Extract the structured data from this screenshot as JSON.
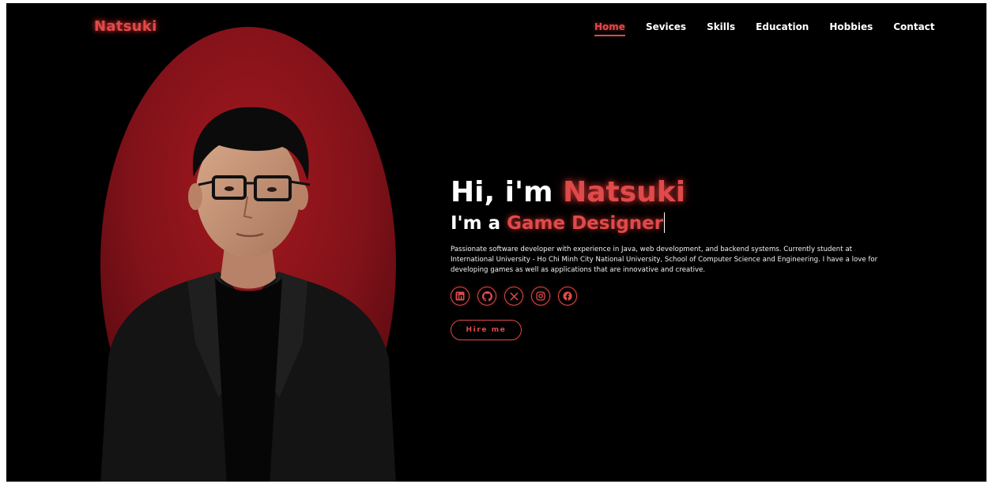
{
  "brand": {
    "name": "Natsuki"
  },
  "nav": {
    "items": [
      {
        "label": "Home",
        "active": true
      },
      {
        "label": "Sevices",
        "active": false
      },
      {
        "label": "Skills",
        "active": false
      },
      {
        "label": "Education",
        "active": false
      },
      {
        "label": "Hobbies",
        "active": false
      },
      {
        "label": "Contact",
        "active": false
      }
    ]
  },
  "hero": {
    "greeting_prefix": "Hi, i'm ",
    "greeting_name": "Natsuki",
    "role_prefix": "I'm a ",
    "role_highlight": "Game Designer",
    "bio": "Passionate software developer with experience in Java, web development, and backend systems. Currently student at International University - Ho Chi Minh City National University, School of Computer Science and Engineering. I have a love for developing games as well as applications that are innovative and creative.",
    "hire_label": "Hire me"
  },
  "socials": [
    {
      "icon": "linkedin-icon"
    },
    {
      "icon": "github-icon"
    },
    {
      "icon": "x-icon"
    },
    {
      "icon": "instagram-icon"
    },
    {
      "icon": "facebook-icon"
    }
  ],
  "colors": {
    "accent": "#e04a4a",
    "background": "#000000",
    "portrait_bg": "#8e1418"
  }
}
